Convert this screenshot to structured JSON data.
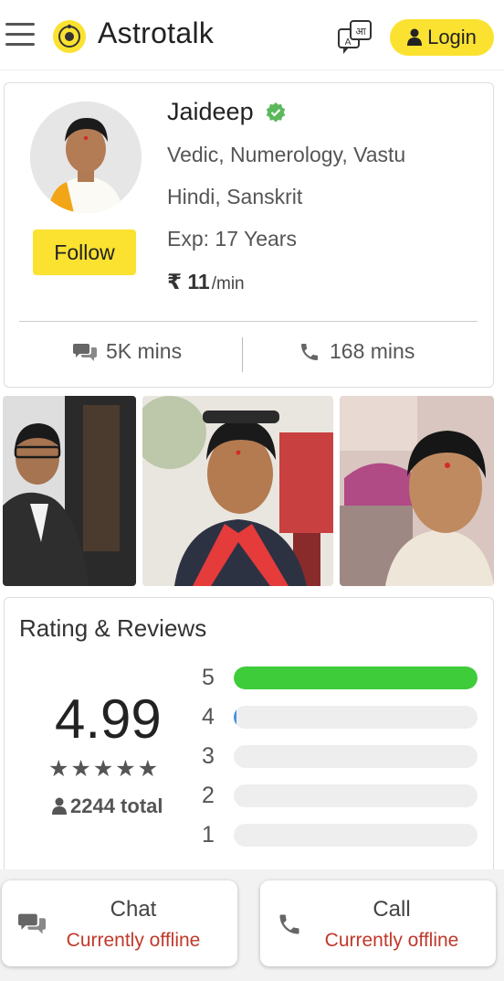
{
  "header": {
    "brand": "Astrotalk",
    "lang_badge": "आ",
    "lang_badge_sub": "A",
    "login_label": "Login"
  },
  "profile": {
    "name": "Jaideep",
    "skills": "Vedic, Numerology, Vastu",
    "languages": "Hindi, Sanskrit",
    "experience": "Exp: 17 Years",
    "price": "₹ 11",
    "price_unit": "/min",
    "follow_label": "Follow",
    "chat_minutes": "5K mins",
    "call_minutes": "168 mins"
  },
  "reviews": {
    "title": "Rating & Reviews",
    "average": "4.99",
    "stars": "★★★★★",
    "total": "2244 total",
    "bars": [
      {
        "label": "5",
        "fraction": 1.0
      },
      {
        "label": "4",
        "fraction": 0.01
      },
      {
        "label": "3",
        "fraction": 0.0
      },
      {
        "label": "2",
        "fraction": 0.0
      },
      {
        "label": "1",
        "fraction": 0.0
      }
    ]
  },
  "actions": {
    "chat_title": "Chat",
    "chat_status": "Currently offline",
    "call_title": "Call",
    "call_status": "Currently offline"
  },
  "colors": {
    "accent_yellow": "#fbe231",
    "bar_green": "#3fcc3b",
    "offline_red": "#c0392b",
    "verified_green": "#5cb85c"
  }
}
